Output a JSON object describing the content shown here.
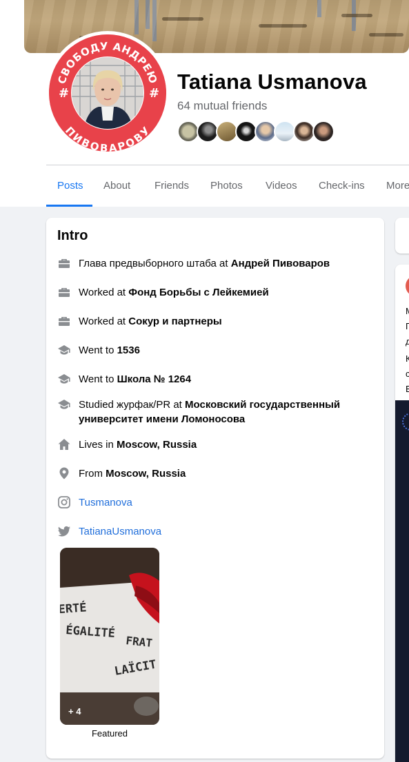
{
  "profile": {
    "name": "Tatiana Usmanova",
    "mutual_friends": "64 mutual friends",
    "avatar_ring_text_top": "СВОБОДУ АНДРЕЮ",
    "avatar_ring_text_bottom": "ПИВОВАРОВУ",
    "avatar_ring_color": "#e8424a"
  },
  "tabs": [
    {
      "label": "Posts",
      "active": true
    },
    {
      "label": "About"
    },
    {
      "label": "Friends"
    },
    {
      "label": "Photos"
    },
    {
      "label": "Videos"
    },
    {
      "label": "Check-ins"
    },
    {
      "label": "More"
    }
  ],
  "intro": {
    "title": "Intro",
    "items": [
      {
        "icon": "briefcase-icon",
        "prefix": "Глава предвыборного штаба at ",
        "bold": "Андрей Пивоваров"
      },
      {
        "icon": "briefcase-icon",
        "prefix": "Worked at ",
        "bold": "Фонд Борьбы с Лейкемией"
      },
      {
        "icon": "briefcase-icon",
        "prefix": "Worked at ",
        "bold": "Сокур и партнеры"
      },
      {
        "icon": "graduation-cap-icon",
        "prefix": "Went to ",
        "bold": "1536"
      },
      {
        "icon": "graduation-cap-icon",
        "prefix": "Went to ",
        "bold": "Школа № 1264"
      },
      {
        "icon": "graduation-cap-icon",
        "prefix": "Studied журфак/PR at ",
        "bold": "Московский государственный университет имени Ломоносова"
      },
      {
        "icon": "home-icon",
        "prefix": "Lives in ",
        "bold": "Moscow, Russia"
      },
      {
        "icon": "location-pin-icon",
        "prefix": "From ",
        "bold": "Moscow, Russia"
      },
      {
        "icon": "instagram-icon",
        "link": "Tusmanova"
      },
      {
        "icon": "twitter-icon",
        "link": "TatianaUsmanova"
      }
    ],
    "featured": {
      "count": "+ 4",
      "label": "Featured",
      "photo_text": [
        "ERTÉ",
        "ÉGALITÉ",
        "FRAT",
        "LAÏCIT"
      ]
    }
  },
  "right_column": {
    "card2_text": [
      "М",
      "П",
      "д",
      "К",
      "с",
      "В"
    ]
  },
  "colors": {
    "accent": "#1877f2",
    "link": "#216fdb",
    "secondary_text": "#65676b",
    "page_bg": "#f0f2f5"
  }
}
